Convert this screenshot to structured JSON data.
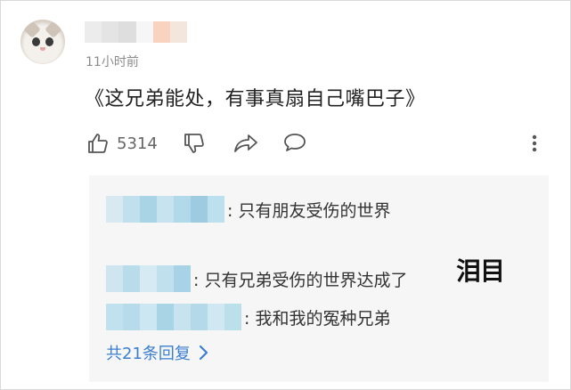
{
  "comment": {
    "timestamp": "11小时前",
    "text": "《这兄弟能处，有事真扇自己嘴巴子》",
    "likes": "5314",
    "username_blur_colors": [
      "#ececec",
      "#e4e4e4",
      "#dedede",
      "#f6f6f6",
      "#f7d3c0",
      "#f3e6dd"
    ]
  },
  "replies": [
    {
      "text": ": 只有朋友受伤的世界",
      "blur_colors": [
        "#d9e9f2",
        "#bfe0ec",
        "#a9d4e6",
        "#c6e3ef",
        "#b2d9ea",
        "#9fcbe0",
        "#bde0ee"
      ]
    },
    {
      "text": ": 只有兄弟受伤的世界达成了",
      "blur_colors": [
        "#cfe6f0",
        "#b9dcea",
        "#d5eaf3",
        "#c0e0ed",
        "#a8d3e6"
      ]
    },
    {
      "text": ": 我和我的冤种兄弟",
      "blur_colors": [
        "#c2e1ee",
        "#b7dbea",
        "#cde7f2",
        "#a9d4e6",
        "#c6e3ef",
        "#b4daea",
        "#cfe8f2",
        "#bcdfec"
      ]
    }
  ],
  "emoji_text": "泪目",
  "more_replies": "共21条回复"
}
